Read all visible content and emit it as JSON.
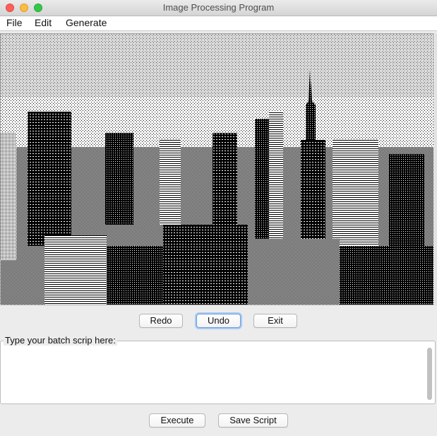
{
  "window": {
    "title": "Image Processing Program"
  },
  "menu": {
    "file": "File",
    "edit": "Edit",
    "generate": "Generate"
  },
  "image": {
    "description_icon": "dithered-city-skyline-image"
  },
  "controls": {
    "redo": "Redo",
    "undo": "Undo",
    "exit": "Exit"
  },
  "script": {
    "legend": "Type your batch scrip here:",
    "value": ""
  },
  "actions": {
    "execute": "Execute",
    "save": "Save Script"
  },
  "colors": {
    "accent_focus": "#6a9ee0",
    "close": "#fc605c",
    "minimize": "#fdbc40",
    "maximize": "#34c84a"
  }
}
